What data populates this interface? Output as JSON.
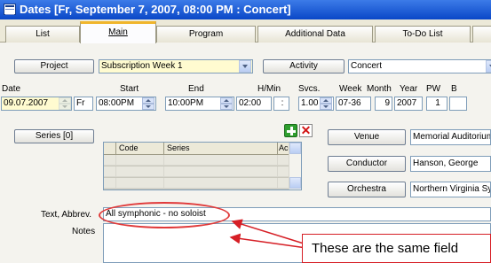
{
  "window": {
    "title": "Dates [Fr, September  7, 2007, 08:00 PM : Concert]"
  },
  "tabs": [
    {
      "label": "List",
      "active": false
    },
    {
      "label": "Main",
      "active": true
    },
    {
      "label": "Program",
      "active": false
    },
    {
      "label": "Additional Data",
      "active": false
    },
    {
      "label": "To-Do List",
      "active": false
    }
  ],
  "project": {
    "button_label": "Project",
    "value": "Subscription Week 1"
  },
  "activity": {
    "button_label": "Activity",
    "value": "Concert"
  },
  "headers": {
    "date": "Date",
    "start": "Start",
    "end": "End",
    "hmin": "H/Min",
    "svcs": "Svcs.",
    "week": "Week",
    "month": "Month",
    "year": "Year",
    "pw": "PW",
    "b": "B"
  },
  "values": {
    "date": "09.07.2007",
    "weekday": "Fr",
    "start": "08:00PM",
    "end": "10:00PM",
    "hmin": "02:00",
    "hmin_sep": ":",
    "svcs": "1.00",
    "week": "07-36",
    "month": "9",
    "year": "2007",
    "pw": "1"
  },
  "series": {
    "button_label": "Series [0]",
    "columns": [
      "Code",
      "Series",
      "Accoun"
    ]
  },
  "venue": {
    "button_label": "Venue",
    "value": "Memorial Auditorium"
  },
  "conductor": {
    "button_label": "Conductor",
    "value": "Hanson, George"
  },
  "orchestra": {
    "button_label": "Orchestra",
    "value": "Northern Virginia Sy"
  },
  "text_abbrev": {
    "label": "Text, Abbrev.",
    "value": "All symphonic - no soloist"
  },
  "notes": {
    "label": "Notes"
  },
  "annotation": {
    "text": "These are the same field",
    "color": "#d61f26"
  },
  "colors": {
    "titlebar": "#0a47c7",
    "active_tab_accent": "#f0b52c",
    "highlight_field": "#fffbd0"
  }
}
